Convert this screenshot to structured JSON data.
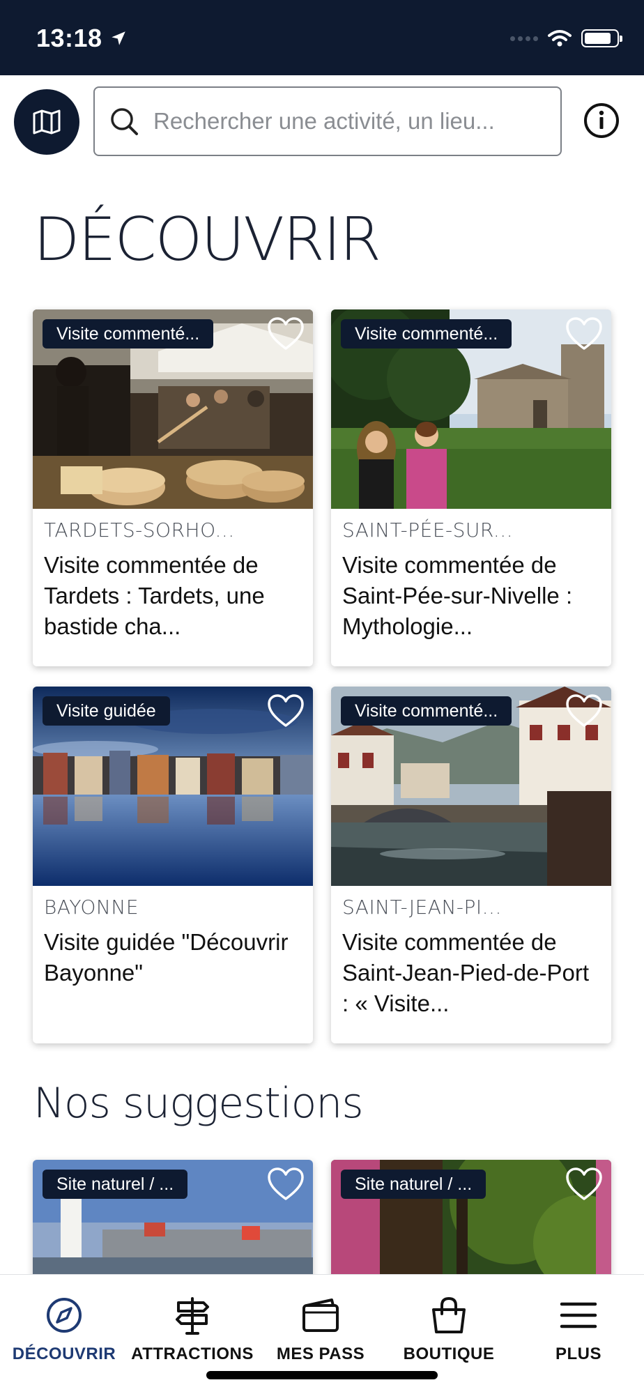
{
  "status_bar": {
    "time": "13:18"
  },
  "header": {
    "search_placeholder": "Rechercher une activité, un lieu...",
    "map_icon": "map-icon",
    "info_icon": "info-icon"
  },
  "discover": {
    "title": "DÉCOUVRIR",
    "cards": [
      {
        "badge": "Visite commenté...",
        "place": "TARDETS-SORHO...",
        "title": "Visite commentée de Tardets : Tardets, une bastide cha..."
      },
      {
        "badge": "Visite commenté...",
        "place": "SAINT-PÉE-SUR...",
        "title": "Visite commentée de Saint-Pée-sur-Nivelle : Mythologie..."
      },
      {
        "badge": "Visite guidée",
        "place": "BAYONNE",
        "title": "Visite guidée \"Découvrir Bayonne\""
      },
      {
        "badge": "Visite commenté...",
        "place": "SAINT-JEAN-PI...",
        "title": "Visite commentée de Saint-Jean-Pied-de-Port : « Visite..."
      }
    ]
  },
  "suggestions": {
    "title": "Nos suggestions",
    "cards": [
      {
        "badge": "Site naturel / ..."
      },
      {
        "badge": "Site naturel / ..."
      }
    ]
  },
  "bottom_nav": {
    "items": [
      {
        "label": "DÉCOUVRIR",
        "icon": "compass-icon",
        "active": true
      },
      {
        "label": "ATTRACTIONS",
        "icon": "signpost-icon",
        "active": false
      },
      {
        "label": "MES PASS",
        "icon": "wallet-icon",
        "active": false
      },
      {
        "label": "BOUTIQUE",
        "icon": "shopping-bag-icon",
        "active": false
      },
      {
        "label": "PLUS",
        "icon": "menu-icon",
        "active": false
      }
    ]
  },
  "colors": {
    "primary": "#0e1a30",
    "active_nav": "#1e3a73",
    "background": "#ffffff"
  }
}
